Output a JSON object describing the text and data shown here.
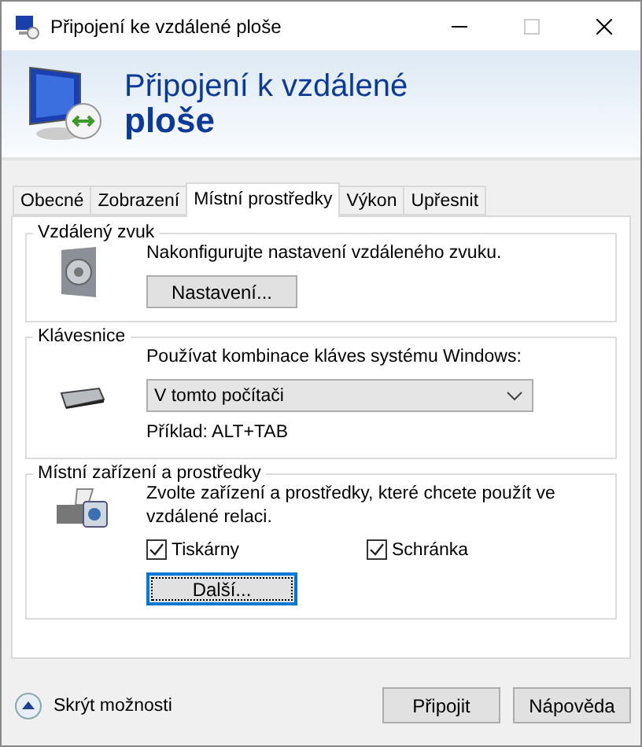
{
  "window": {
    "title": "Připojení ke vzdálené ploše"
  },
  "banner": {
    "line1": "Připojení k vzdálené",
    "line2": "ploše"
  },
  "tabs": [
    {
      "label": "Obecné",
      "selected": false
    },
    {
      "label": "Zobrazení",
      "selected": false
    },
    {
      "label": "Místní prostředky",
      "selected": true
    },
    {
      "label": "Výkon",
      "selected": false
    },
    {
      "label": "Upřesnit",
      "selected": false
    }
  ],
  "audio": {
    "title": "Vzdálený zvuk",
    "text": "Nakonfigurujte nastavení vzdáleného zvuku.",
    "button": "Nastavení..."
  },
  "keyboard": {
    "title": "Klávesnice",
    "label": "Používat kombinace kláves systému Windows:",
    "value": "V tomto počítači",
    "example": "Příklad: ALT+TAB"
  },
  "devices": {
    "title": "Místní zařízení a prostředky",
    "text": "Zvolte zařízení a prostředky, které chcete použít ve vzdálené relaci.",
    "options": [
      {
        "label": "Tiskárny",
        "checked": true
      },
      {
        "label": "Schránka",
        "checked": true
      }
    ],
    "button": "Další..."
  },
  "footer": {
    "toggle": "Skrýt možnosti",
    "buttons": [
      "Připojit",
      "Nápověda"
    ]
  }
}
